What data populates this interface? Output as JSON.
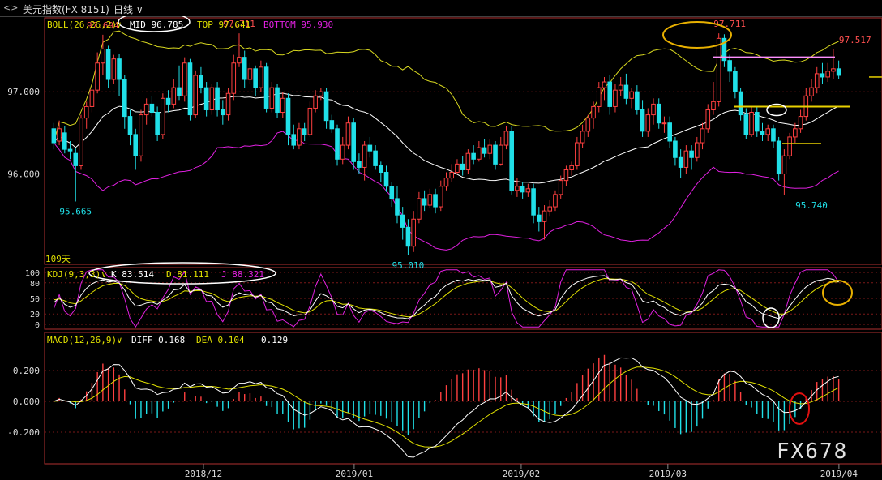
{
  "header": {
    "nav_icon": "back-forward-arrows",
    "symbol": "美元指数(FX 8151)",
    "timeframe": "日线"
  },
  "watermark": "FX678",
  "chart_data": {
    "type": "candlestick",
    "price_axis": {
      "labels": [
        "97.000",
        "96.000"
      ],
      "values": [
        97.0,
        96.0
      ],
      "ylim": [
        94.9,
        97.9
      ]
    },
    "x_labels": [
      "2018/12",
      "2019/01",
      "2019/02",
      "2019/03",
      "2019/04"
    ],
    "period_label": "109天",
    "boll": {
      "name": "BOLL(26,26,2)",
      "mid_label": "MID 96.785",
      "top_label": "TOP 97.641",
      "bottom_label": "BOTTOM 95.930",
      "mid": 96.785,
      "top": 97.641,
      "bottom": 95.93
    },
    "price_annotations": [
      {
        "text": "97.694",
        "value": 97.694
      },
      {
        "text": "97.711",
        "value": 97.711
      },
      {
        "text": "97.711",
        "value": 97.711
      },
      {
        "text": "97.517",
        "value": 97.517
      },
      {
        "text": "95.665",
        "value": 95.665
      },
      {
        "text": "95.010",
        "value": 95.01
      },
      {
        "text": "95.740",
        "value": 95.74
      }
    ],
    "kdj": {
      "name": "KDJ(9,3,3)",
      "k_label": "K 83.514",
      "d_label": "D 81.111",
      "j_label": "J 88.321",
      "k": 83.514,
      "d": 81.111,
      "j": 88.321,
      "axis_labels": [
        "100",
        "80",
        "50",
        "20",
        "0"
      ],
      "axis_values": [
        100,
        80,
        50,
        20,
        0
      ]
    },
    "macd": {
      "name": "MACD(12,26,9)",
      "diff_label": "DIFF 0.168",
      "dea_label": "DEA 0.104",
      "macd_label": "0.129",
      "diff": 0.168,
      "dea": 0.104,
      "macd": 0.129,
      "axis_labels": [
        "0.200",
        "0.000",
        "-0.200"
      ],
      "axis_values": [
        0.2,
        0.0,
        -0.2
      ]
    },
    "candles": [
      [
        96.55,
        96.38,
        96.62,
        96.3
      ],
      [
        96.4,
        96.55,
        96.65,
        96.35
      ],
      [
        96.5,
        96.3,
        96.58,
        96.25
      ],
      [
        96.3,
        96.28,
        96.4,
        96.18
      ],
      [
        96.25,
        96.1,
        96.32,
        95.665
      ],
      [
        96.1,
        96.68,
        96.72,
        96.05
      ],
      [
        96.68,
        96.82,
        96.88,
        96.55
      ],
      [
        96.82,
        97.02,
        97.08,
        96.75
      ],
      [
        97.02,
        97.35,
        97.48,
        96.98
      ],
      [
        97.35,
        97.52,
        97.694,
        97.2
      ],
      [
        97.52,
        97.15,
        97.56,
        97.05
      ],
      [
        97.15,
        97.4,
        97.45,
        97.1
      ],
      [
        97.4,
        97.15,
        97.46,
        96.95
      ],
      [
        97.15,
        96.7,
        97.2,
        96.55
      ],
      [
        96.7,
        96.48,
        96.78,
        96.35
      ],
      [
        96.48,
        96.22,
        96.55,
        96.05
      ],
      [
        96.22,
        96.72,
        96.78,
        96.15
      ],
      [
        96.72,
        96.85,
        96.92,
        96.6
      ],
      [
        96.85,
        96.75,
        96.95,
        96.7
      ],
      [
        96.75,
        96.48,
        96.82,
        96.4
      ],
      [
        96.48,
        96.92,
        96.98,
        96.42
      ],
      [
        96.92,
        96.85,
        97.02,
        96.75
      ],
      [
        96.85,
        97.05,
        97.15,
        96.8
      ],
      [
        97.05,
        96.95,
        97.32,
        96.9
      ],
      [
        96.95,
        97.35,
        97.42,
        96.88
      ],
      [
        97.35,
        96.72,
        97.4,
        96.65
      ],
      [
        96.72,
        97.2,
        97.26,
        96.68
      ],
      [
        97.2,
        97.05,
        97.3,
        96.98
      ],
      [
        97.05,
        96.78,
        97.12,
        96.7
      ],
      [
        96.78,
        97.05,
        97.1,
        96.72
      ],
      [
        97.05,
        96.78,
        97.12,
        96.7
      ],
      [
        96.78,
        96.72,
        96.9,
        96.6
      ],
      [
        96.72,
        96.98,
        97.05,
        96.65
      ],
      [
        96.98,
        97.35,
        97.45,
        96.9
      ],
      [
        97.35,
        97.42,
        97.711,
        97.3
      ],
      [
        97.42,
        97.15,
        97.5,
        97.05
      ],
      [
        97.15,
        97.28,
        97.35,
        97.1
      ],
      [
        97.28,
        97.05,
        97.32,
        96.95
      ],
      [
        97.05,
        97.3,
        97.38,
        97.0
      ],
      [
        97.3,
        96.8,
        97.35,
        96.75
      ],
      [
        96.8,
        97.05,
        97.12,
        96.75
      ],
      [
        97.05,
        96.75,
        97.1,
        96.68
      ],
      [
        96.75,
        96.92,
        97.0,
        96.68
      ],
      [
        96.92,
        96.48,
        96.98,
        96.35
      ],
      [
        96.48,
        96.35,
        96.6,
        96.3
      ],
      [
        96.35,
        96.55,
        96.62,
        96.3
      ],
      [
        96.55,
        96.48,
        96.62,
        96.4
      ],
      [
        96.48,
        96.8,
        96.88,
        96.45
      ],
      [
        96.8,
        96.95,
        97.02,
        96.75
      ],
      [
        96.95,
        97.0,
        97.05,
        96.9
      ],
      [
        97.0,
        96.65,
        97.05,
        96.55
      ],
      [
        96.65,
        96.55,
        96.72,
        96.5
      ],
      [
        96.55,
        96.18,
        96.6,
        96.1
      ],
      [
        96.18,
        96.35,
        96.45,
        96.12
      ],
      [
        96.35,
        96.62,
        96.7,
        96.3
      ],
      [
        96.62,
        96.15,
        96.68,
        96.05
      ],
      [
        96.15,
        96.08,
        96.25,
        96.0
      ],
      [
        96.08,
        96.35,
        96.4,
        95.92
      ],
      [
        96.35,
        96.28,
        96.45,
        96.2
      ],
      [
        96.28,
        96.1,
        96.35,
        96.05
      ],
      [
        96.1,
        96.02,
        96.15,
        95.9
      ],
      [
        96.02,
        95.85,
        96.1,
        95.78
      ],
      [
        95.85,
        95.7,
        95.9,
        95.6
      ],
      [
        95.7,
        95.5,
        95.85,
        95.4
      ],
      [
        95.5,
        95.35,
        95.6,
        95.2
      ],
      [
        95.35,
        95.12,
        95.45,
        95.01
      ],
      [
        95.12,
        95.45,
        95.55,
        95.05
      ],
      [
        95.45,
        95.7,
        95.78,
        95.4
      ],
      [
        95.7,
        95.62,
        95.8,
        95.55
      ],
      [
        95.62,
        95.75,
        95.82,
        95.58
      ],
      [
        95.75,
        95.6,
        95.82,
        95.52
      ],
      [
        95.6,
        95.85,
        95.92,
        95.55
      ],
      [
        95.85,
        95.95,
        96.02,
        95.8
      ],
      [
        95.95,
        96.02,
        96.12,
        95.9
      ],
      [
        96.02,
        96.12,
        96.18,
        96.0
      ],
      [
        96.12,
        96.05,
        96.22,
        95.98
      ],
      [
        96.05,
        96.25,
        96.3,
        96.0
      ],
      [
        96.25,
        96.18,
        96.35,
        96.12
      ],
      [
        96.18,
        96.32,
        96.4,
        96.15
      ],
      [
        96.32,
        96.25,
        96.42,
        96.2
      ],
      [
        96.25,
        96.35,
        96.42,
        96.18
      ],
      [
        96.35,
        96.12,
        96.4,
        96.05
      ],
      [
        96.12,
        96.35,
        96.45,
        96.1
      ],
      [
        96.35,
        96.52,
        96.58,
        96.3
      ],
      [
        96.52,
        95.8,
        96.58,
        95.75
      ],
      [
        95.8,
        95.85,
        95.95,
        95.72
      ],
      [
        95.85,
        95.78,
        95.9,
        95.7
      ],
      [
        95.78,
        95.82,
        95.88,
        95.72
      ],
      [
        95.82,
        95.5,
        95.88,
        95.4
      ],
      [
        95.5,
        95.42,
        95.6,
        95.3
      ],
      [
        95.42,
        95.55,
        95.62,
        95.2
      ],
      [
        95.55,
        95.6,
        95.68,
        95.48
      ],
      [
        95.6,
        95.75,
        95.8,
        95.55
      ],
      [
        95.75,
        95.92,
        95.98,
        95.7
      ],
      [
        95.92,
        96.05,
        96.1,
        95.85
      ],
      [
        96.05,
        96.1,
        96.15,
        95.98
      ],
      [
        96.1,
        96.38,
        96.45,
        96.05
      ],
      [
        96.38,
        96.52,
        96.6,
        96.32
      ],
      [
        96.52,
        96.68,
        96.72,
        96.45
      ],
      [
        96.68,
        96.82,
        96.88,
        96.55
      ],
      [
        96.82,
        97.05,
        97.12,
        96.75
      ],
      [
        97.05,
        97.12,
        97.18,
        96.9
      ],
      [
        97.12,
        96.82,
        97.2,
        96.72
      ],
      [
        96.82,
        97.02,
        97.1,
        96.75
      ],
      [
        97.02,
        97.08,
        97.18,
        96.95
      ],
      [
        97.08,
        96.92,
        97.22,
        96.85
      ],
      [
        96.92,
        97.0,
        97.05,
        96.8
      ],
      [
        97.0,
        96.78,
        97.08,
        96.72
      ],
      [
        96.78,
        96.52,
        96.9,
        96.45
      ],
      [
        96.52,
        96.72,
        96.8,
        96.45
      ],
      [
        96.72,
        96.85,
        96.92,
        96.6
      ],
      [
        96.85,
        96.62,
        96.92,
        96.55
      ],
      [
        96.62,
        96.62,
        96.7,
        96.5
      ],
      [
        96.62,
        96.4,
        96.7,
        96.32
      ],
      [
        96.4,
        96.2,
        96.45,
        96.1
      ],
      [
        96.2,
        96.08,
        96.3,
        95.95
      ],
      [
        96.08,
        96.28,
        96.35,
        96.0
      ],
      [
        96.28,
        96.2,
        96.35,
        96.05
      ],
      [
        96.2,
        96.38,
        96.45,
        96.15
      ],
      [
        96.38,
        96.55,
        96.62,
        96.3
      ],
      [
        96.55,
        96.78,
        96.85,
        96.5
      ],
      [
        96.78,
        96.88,
        97.12,
        96.72
      ],
      [
        96.88,
        97.65,
        97.711,
        96.82
      ],
      [
        97.65,
        97.38,
        97.7,
        97.3
      ],
      [
        97.38,
        97.25,
        97.45,
        97.12
      ],
      [
        97.25,
        97.0,
        97.3,
        96.92
      ],
      [
        97.0,
        96.72,
        97.05,
        96.65
      ],
      [
        96.72,
        96.48,
        96.8,
        96.42
      ],
      [
        96.48,
        96.75,
        96.82,
        96.45
      ],
      [
        96.75,
        96.52,
        96.82,
        96.45
      ],
      [
        96.52,
        96.48,
        96.62,
        96.4
      ],
      [
        96.48,
        96.55,
        96.6,
        96.4
      ],
      [
        96.55,
        96.4,
        96.6,
        96.32
      ],
      [
        96.4,
        96.0,
        96.45,
        95.92
      ],
      [
        96.0,
        96.22,
        96.3,
        95.74
      ],
      [
        96.22,
        96.45,
        96.5,
        96.18
      ],
      [
        96.45,
        96.55,
        96.62,
        96.38
      ],
      [
        96.55,
        96.7,
        96.78,
        96.5
      ],
      [
        96.7,
        96.95,
        97.05,
        96.65
      ],
      [
        96.95,
        97.05,
        97.15,
        96.88
      ],
      [
        97.05,
        97.22,
        97.3,
        96.98
      ],
      [
        97.22,
        97.18,
        97.35,
        97.1
      ],
      [
        97.18,
        97.25,
        97.35,
        97.12
      ],
      [
        97.25,
        97.28,
        97.517,
        97.15
      ],
      [
        97.28,
        97.2,
        97.38,
        97.15
      ]
    ]
  }
}
